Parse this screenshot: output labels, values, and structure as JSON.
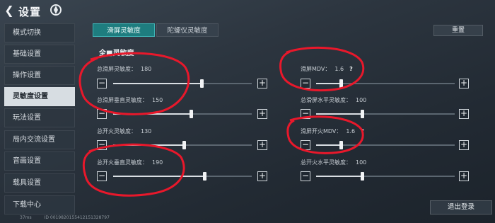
{
  "header": {
    "back_icon": "back-arrow-icon",
    "title": "设置",
    "brand_icon": "game-logo-icon"
  },
  "sidebar": {
    "items": [
      {
        "label": "模式切换"
      },
      {
        "label": "基础设置"
      },
      {
        "label": "操作设置"
      },
      {
        "label": "灵敏度设置",
        "active": true
      },
      {
        "label": "玩法设置"
      },
      {
        "label": "局内交流设置"
      },
      {
        "label": "音画设置"
      },
      {
        "label": "载具设置"
      },
      {
        "label": "下载中心"
      }
    ]
  },
  "tabs": [
    {
      "label": "滑屏灵敏度",
      "active": true
    },
    {
      "label": "陀螺仪灵敏度",
      "active": false
    }
  ],
  "reset_label": "重置",
  "section_title": "全■灵敏度",
  "settings": {
    "s1": {
      "label": "总滑屏灵敏度：",
      "value": "180",
      "fraction": 0.64
    },
    "s2": {
      "label": "总滑屏垂直灵敏度：",
      "value": "150",
      "fraction": 0.56
    },
    "s3": {
      "label": "总开火灵敏度：",
      "value": "130",
      "fraction": 0.51
    },
    "s4": {
      "label": "总开火垂直灵敏度：",
      "value": "190",
      "fraction": 0.66
    },
    "r1": {
      "label": "滑屏MDV：",
      "value": "1.6",
      "help": "?",
      "fraction": 0.18
    },
    "r2": {
      "label": "总滑屏水平灵敏度：",
      "value": "100",
      "fraction": 0.33
    },
    "r3": {
      "label": "滑屏开火MDV：",
      "value": "1.6",
      "help": "?",
      "fraction": 0.18
    },
    "r4": {
      "label": "总开火水平灵敏度：",
      "value": "100",
      "fraction": 0.33
    }
  },
  "logout_label": "退出登录",
  "footer": {
    "ping": "37ms",
    "id": "ID 0019820155412151328797"
  },
  "annotation_color": "#e8182b"
}
